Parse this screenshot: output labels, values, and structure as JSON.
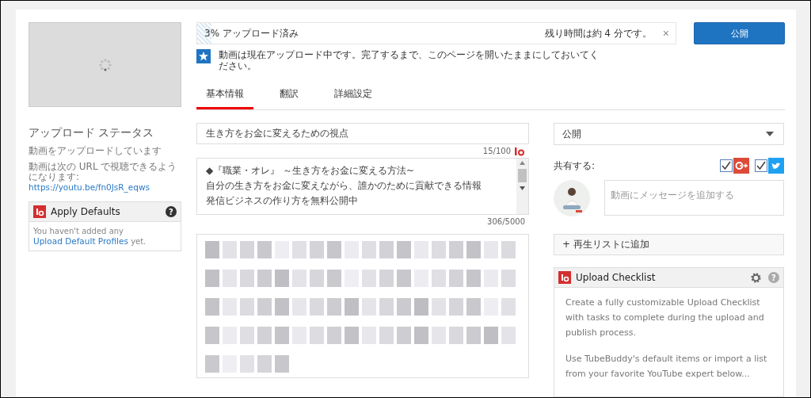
{
  "upload_status": {
    "title": "アップロード ステータス",
    "message": "動画をアップロードしています",
    "url_note": "動画は次の URL で視聴できるようになります:",
    "url": "https://youtu.be/fn0JsR_eqws"
  },
  "apply_defaults": {
    "title": "Apply Defaults",
    "help": "?",
    "text_before": "You haven't added any ",
    "link": "Upload Default Profiles",
    "text_after": " yet."
  },
  "progress": {
    "label": "3% アップロード済み",
    "level": 0.03,
    "remaining": "残り時間は約 4 分です。",
    "close": "×"
  },
  "publish_button": "公開",
  "notice": "動画は現在アップロード中です。完了するまで、このページを開いたままにしておいてください。",
  "tabs": [
    {
      "label": "基本情報",
      "selected": true
    },
    {
      "label": "翻訳",
      "selected": false
    },
    {
      "label": "詳細設定",
      "selected": false
    }
  ],
  "title_field": {
    "value": "生き方をお金に変えるための視点",
    "count": "15/100"
  },
  "description_field": {
    "lines": [
      "◆『職業・オレ』 ～生き方をお金に変える方法~",
      "自分の生き方をお金に変えながら、誰かのために貢献できる情報",
      "発信ビジネスの作り方を無料公開中"
    ],
    "count": "306/5000"
  },
  "privacy_select": {
    "value": "公開"
  },
  "share": {
    "label": "共有する:",
    "networks": [
      {
        "kind": "googleplus",
        "checked": true
      },
      {
        "kind": "twitter",
        "checked": true
      }
    ],
    "placeholder": "動画にメッセージを追加する"
  },
  "playlist_button": "+ 再生リストに追加",
  "upload_checklist": {
    "title": "Upload Checklist",
    "help": "?",
    "paragraphs": [
      "Create a fully customizable Upload Checklist with tasks to complete during the upload and publish process.",
      "Use TubeBuddy's default items or import a list from your favorite YouTube expert below..."
    ]
  }
}
